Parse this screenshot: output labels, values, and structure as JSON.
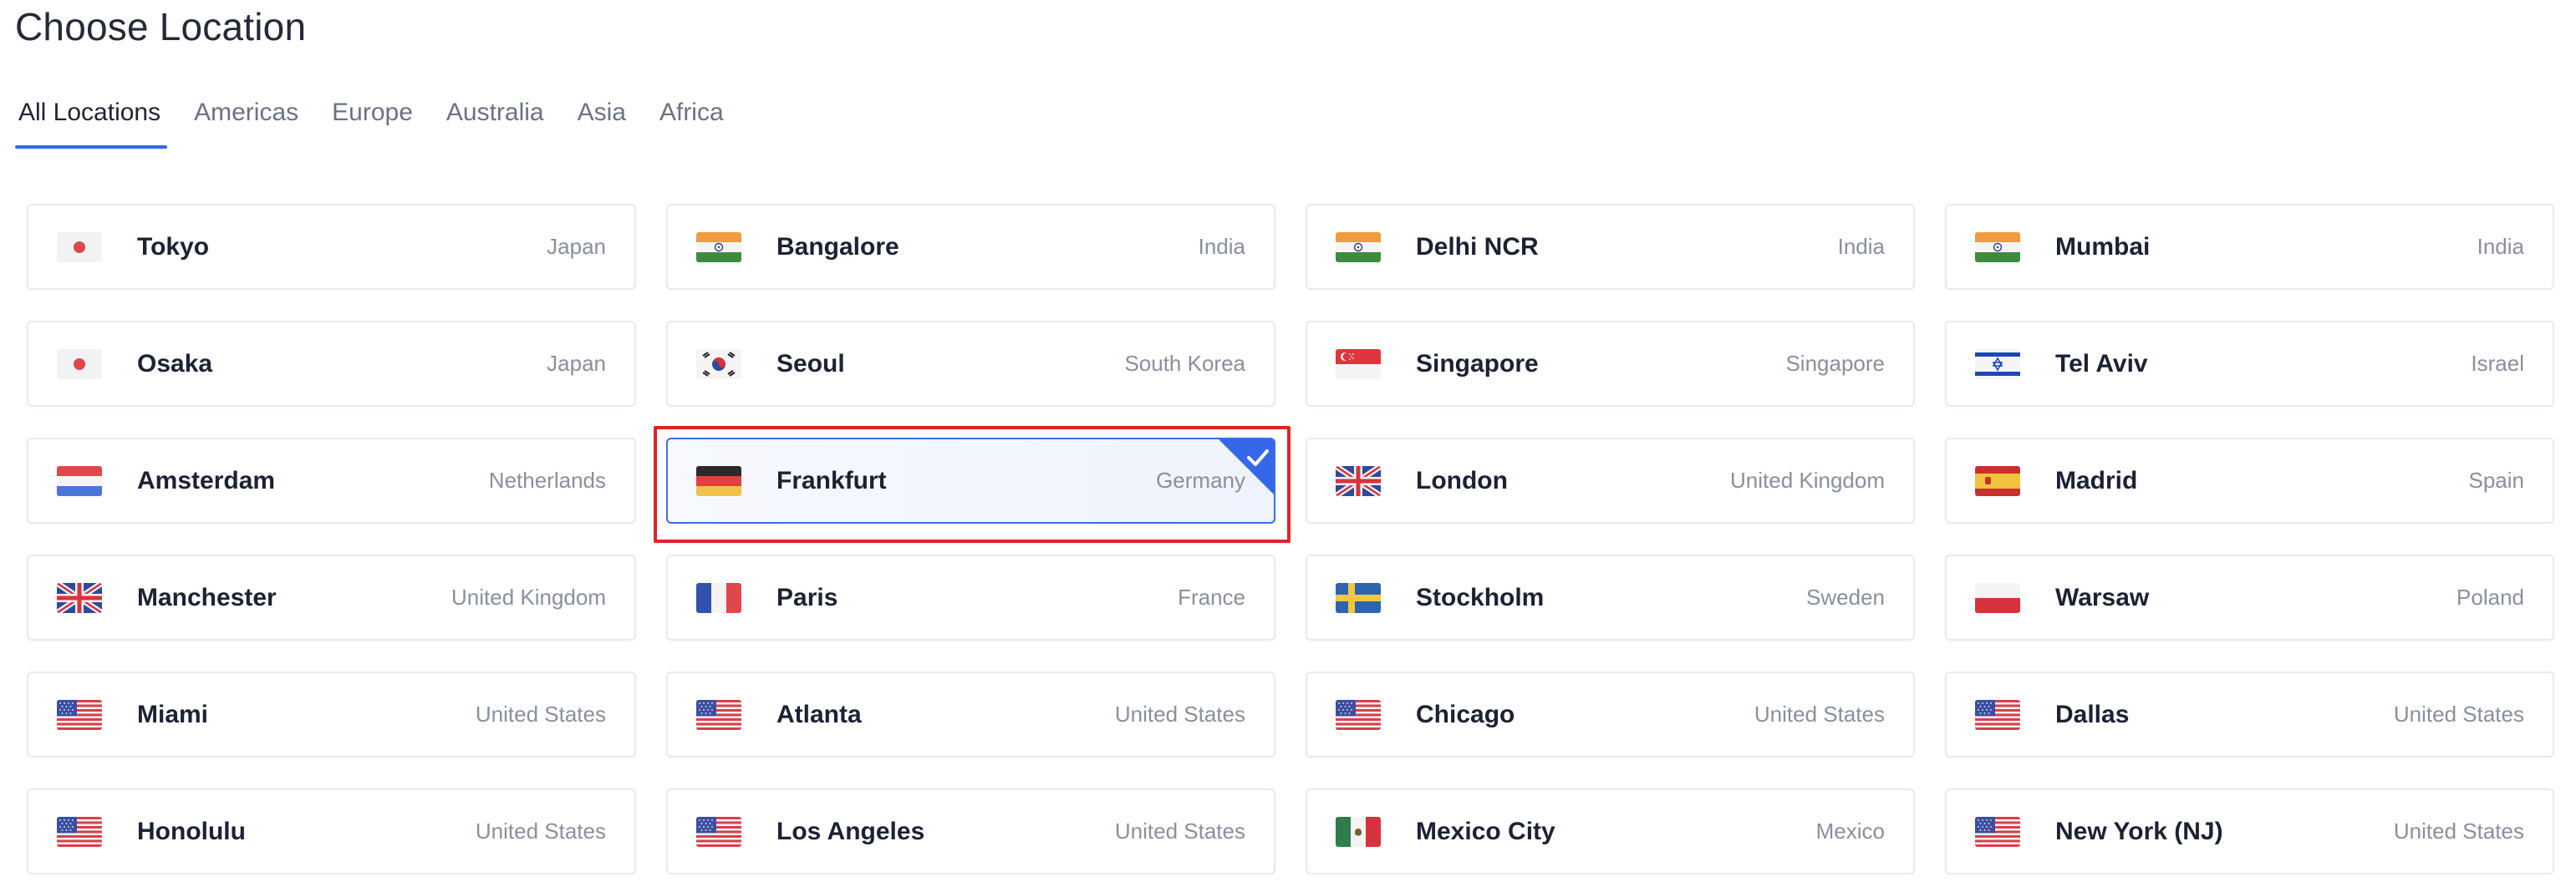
{
  "header": {
    "title": "Choose Location"
  },
  "tabs": [
    {
      "label": "All Locations",
      "active": true
    },
    {
      "label": "Americas",
      "active": false
    },
    {
      "label": "Europe",
      "active": false
    },
    {
      "label": "Australia",
      "active": false
    },
    {
      "label": "Asia",
      "active": false
    },
    {
      "label": "Africa",
      "active": false
    }
  ],
  "colors": {
    "accent": "#3468e8",
    "highlight": "#e0222a",
    "muted_text": "#8a8f9c"
  },
  "locations": [
    {
      "city": "Tokyo",
      "country": "Japan",
      "flag": "japan-flag-icon"
    },
    {
      "city": "Bangalore",
      "country": "India",
      "flag": "india-flag-icon"
    },
    {
      "city": "Delhi NCR",
      "country": "India",
      "flag": "india-flag-icon"
    },
    {
      "city": "Mumbai",
      "country": "India",
      "flag": "india-flag-icon"
    },
    {
      "city": "Osaka",
      "country": "Japan",
      "flag": "japan-flag-icon"
    },
    {
      "city": "Seoul",
      "country": "South Korea",
      "flag": "south-korea-flag-icon"
    },
    {
      "city": "Singapore",
      "country": "Singapore",
      "flag": "singapore-flag-icon"
    },
    {
      "city": "Tel Aviv",
      "country": "Israel",
      "flag": "israel-flag-icon"
    },
    {
      "city": "Amsterdam",
      "country": "Netherlands",
      "flag": "netherlands-flag-icon"
    },
    {
      "city": "Frankfurt",
      "country": "Germany",
      "flag": "germany-flag-icon",
      "selected": true
    },
    {
      "city": "London",
      "country": "United Kingdom",
      "flag": "uk-flag-icon"
    },
    {
      "city": "Madrid",
      "country": "Spain",
      "flag": "spain-flag-icon"
    },
    {
      "city": "Manchester",
      "country": "United Kingdom",
      "flag": "uk-flag-icon"
    },
    {
      "city": "Paris",
      "country": "France",
      "flag": "france-flag-icon"
    },
    {
      "city": "Stockholm",
      "country": "Sweden",
      "flag": "sweden-flag-icon"
    },
    {
      "city": "Warsaw",
      "country": "Poland",
      "flag": "poland-flag-icon"
    },
    {
      "city": "Miami",
      "country": "United States",
      "flag": "usa-flag-icon"
    },
    {
      "city": "Atlanta",
      "country": "United States",
      "flag": "usa-flag-icon"
    },
    {
      "city": "Chicago",
      "country": "United States",
      "flag": "usa-flag-icon"
    },
    {
      "city": "Dallas",
      "country": "United States",
      "flag": "usa-flag-icon"
    },
    {
      "city": "Honolulu",
      "country": "United States",
      "flag": "usa-flag-icon"
    },
    {
      "city": "Los Angeles",
      "country": "United States",
      "flag": "usa-flag-icon"
    },
    {
      "city": "Mexico City",
      "country": "Mexico",
      "flag": "mexico-flag-icon"
    },
    {
      "city": "New York (NJ)",
      "country": "United States",
      "flag": "usa-flag-icon"
    }
  ]
}
